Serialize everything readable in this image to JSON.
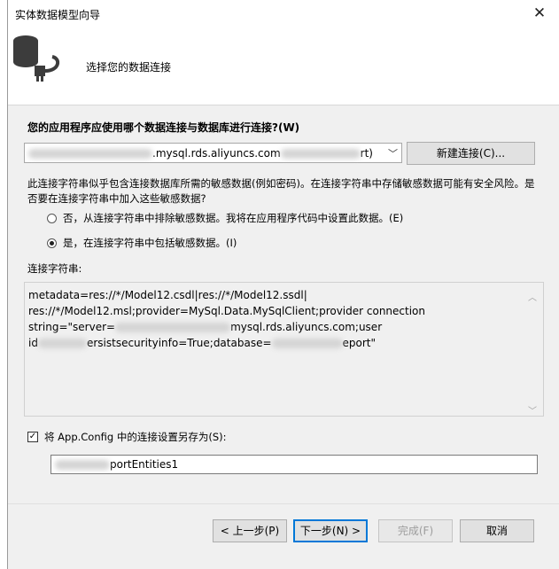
{
  "window": {
    "title": "实体数据模型向导"
  },
  "header": {
    "title": "选择您的数据连接",
    "icon": "database-plug-icon"
  },
  "connection": {
    "question": "您的应用程序应使用哪个数据连接与数据库进行连接?(W)",
    "selected_value": ".mysql.rds.aliyuncs.com",
    "selected_value_tail": "rt)",
    "new_connection_label": "新建连接(C)..."
  },
  "sensitive": {
    "description": "此连接字符串似乎包含连接数据库所需的敏感数据(例如密码)。在连接字符串中存储敏感数据可能有安全风险。是否要在连接字符串中加入这些敏感数据?",
    "option_exclude": "否，从连接字符串中排除敏感数据。我将在应用程序代码中设置此数据。(E)",
    "option_include": "是，在连接字符串中包括敏感数据。(I)",
    "selected": "include"
  },
  "connection_string": {
    "label": "连接字符串:",
    "line1": "metadata=res://*/Model12.csdl|res://*/Model12.ssdl|",
    "line2": "res://*/Model12.msl;provider=MySql.Data.MySqlClient;provider connection",
    "line3a": "string=\"server=",
    "line3b": "mysql.rds.aliyuncs.com;user",
    "line4a": "id",
    "line4b": "ersistsecurityinfo=True;database=",
    "line4c": "eport\""
  },
  "save_config": {
    "label": "将 App.Config 中的连接设置另存为(S):",
    "checked": true,
    "value": "portEntities1"
  },
  "buttons": {
    "back": "< 上一步(P)",
    "next": "下一步(N) >",
    "finish": "完成(F)",
    "cancel": "取消"
  },
  "colors": {
    "dialog_bg": "#f0f0f0",
    "accent": "#0078d7"
  }
}
